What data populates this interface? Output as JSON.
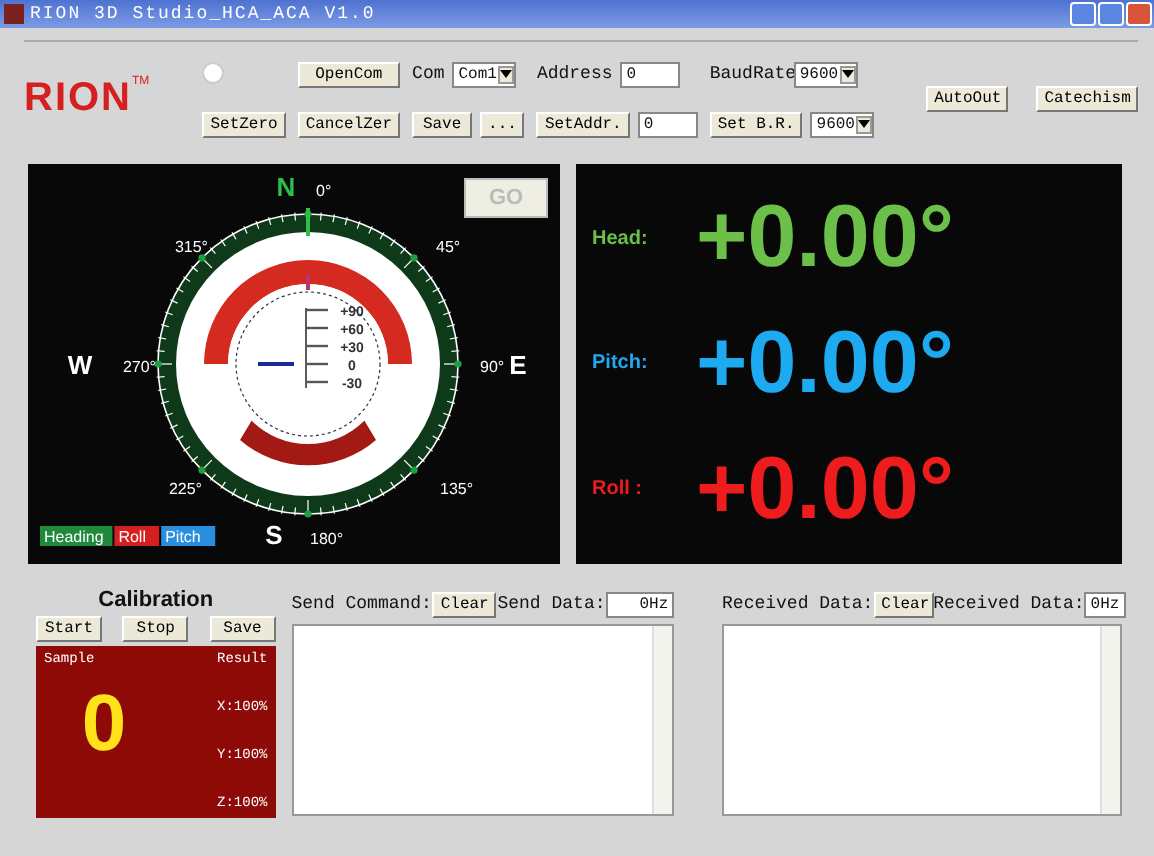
{
  "window": {
    "title": "RION 3D Studio_HCA_ACA V1.0"
  },
  "toolbar": {
    "logo": "RION",
    "logo_mark": "TM",
    "open_button": "OpenCom",
    "setzero_button": "SetZero",
    "cancel_button": "CancelZer",
    "com_label": "Com",
    "com_value": "Com1",
    "save_button": "Save",
    "more_button": "...",
    "address_label": "Address",
    "address_value": "0",
    "setaddr_button": "SetAddr.",
    "setaddr_value": "0",
    "baud_label": "BaudRate",
    "baud_value": "9600",
    "setbr_button": "Set B.R.",
    "setbr_value": "9600",
    "autoout_button": "AutoOut",
    "catechism_button": "Catechism"
  },
  "compass": {
    "go_button": "GO",
    "labels": [
      {
        "text": "N",
        "kind": "cardinal"
      },
      {
        "text": "0°",
        "kind": "degree"
      },
      {
        "text": "45°",
        "kind": "degree"
      },
      {
        "text": "90°",
        "kind": "degree"
      },
      {
        "text": "E",
        "kind": "cardinal"
      },
      {
        "text": "135°",
        "kind": "degree"
      },
      {
        "text": "S",
        "kind": "cardinal"
      },
      {
        "text": "180°",
        "kind": "degree"
      },
      {
        "text": "225°",
        "kind": "degree"
      },
      {
        "text": "W",
        "kind": "cardinal"
      },
      {
        "text": "270°",
        "kind": "degree"
      },
      {
        "text": "315°",
        "kind": "degree"
      }
    ],
    "pitch_scale": [
      "+90",
      "+60",
      "+30",
      "0",
      "-30"
    ],
    "legend": [
      {
        "text": "Heading",
        "color": "#1f8a3c"
      },
      {
        "text": "Roll",
        "color": "#d42020"
      },
      {
        "text": "Pitch",
        "color": "#2a8ee0"
      }
    ]
  },
  "readouts": [
    {
      "label": "Head:",
      "value": "+0.00°",
      "color": "#6cc04a"
    },
    {
      "label": "Pitch:",
      "value": "+0.00°",
      "color": "#1eaaf0"
    },
    {
      "label": "Roll :",
      "value": "+0.00°",
      "color": "#ee1c1c"
    }
  ],
  "calibration": {
    "title": "Calibration",
    "buttons": [
      "Start",
      "Stop",
      "Save"
    ],
    "sample_label": "Sample",
    "sample_value": "0",
    "result_label": "Result",
    "results": [
      "X:100%",
      "Y:100%",
      "Z:100%"
    ]
  },
  "send": {
    "label": "Send Command:",
    "clear_button": "Clear",
    "rate_label": "Send Data:",
    "rate_value": "0Hz"
  },
  "receive": {
    "label": "Received Data:",
    "clear_button": "Clear",
    "rate_label": "Received Data:",
    "rate_value": "0Hz"
  }
}
